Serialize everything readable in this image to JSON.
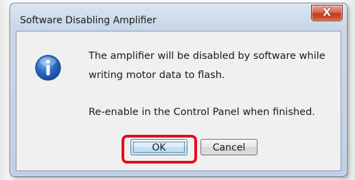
{
  "dialog": {
    "title": "Software Disabling Amplifier",
    "close_label": "X",
    "icon": "information-icon",
    "message_line1": "The amplifier will be disabled by software while",
    "message_line2": "writing motor data to flash.",
    "message_line3": "Re-enable in the Control Panel when finished.",
    "ok_label": "OK",
    "cancel_label": "Cancel"
  },
  "annotation": {
    "highlight_color": "#e0101c",
    "highlight_target": "ok-button"
  },
  "colors": {
    "info_icon_blue": "#2a6cc6",
    "close_red": "#c43b1e"
  }
}
